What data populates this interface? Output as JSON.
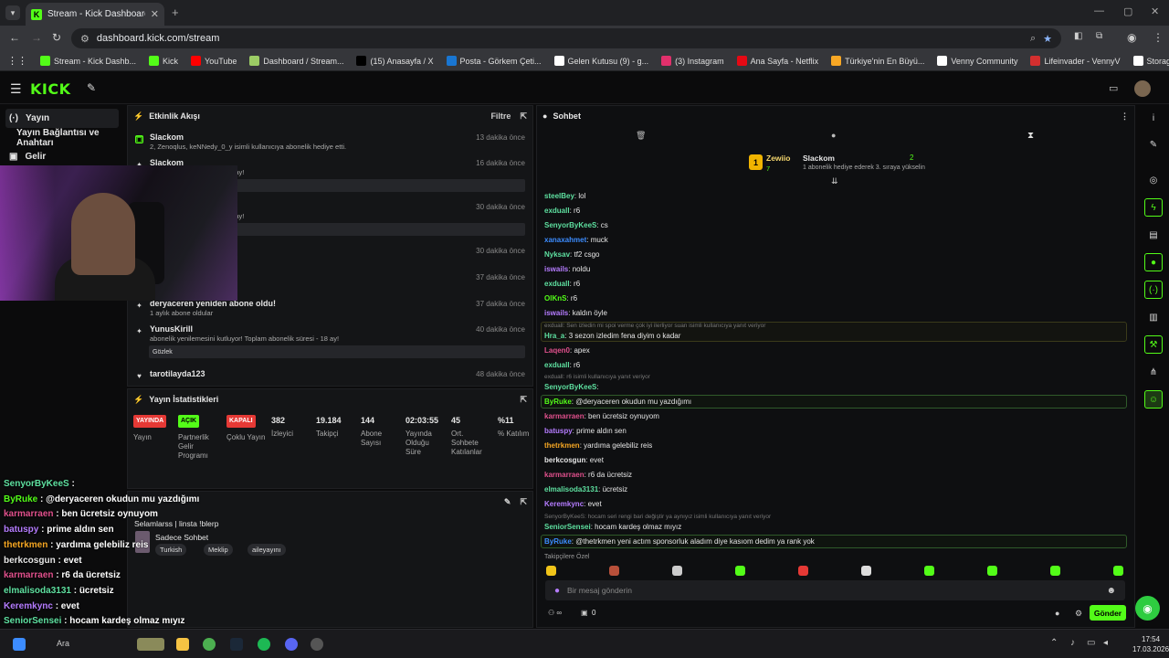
{
  "browser": {
    "tab_title": "Stream - Kick Dashboard",
    "url": "dashboard.kick.com/stream",
    "bookmarks": [
      {
        "label": "Stream - Kick Dashb...",
        "icon": "kick-icon",
        "color": "#53fc18"
      },
      {
        "label": "Kick",
        "icon": "kick-icon",
        "color": "#53fc18"
      },
      {
        "label": "YouTube",
        "icon": "youtube-icon",
        "color": "#ff0000"
      },
      {
        "label": "Dashboard / Stream...",
        "icon": "dashboard-icon",
        "color": "#9ccc65"
      },
      {
        "label": "(15) Anasayfa / X",
        "icon": "x-icon",
        "color": "#000000"
      },
      {
        "label": "Posta - Görkem Çeti...",
        "icon": "mail-icon",
        "color": "#1976d2"
      },
      {
        "label": "Gelen Kutusu (9) - g...",
        "icon": "google-icon",
        "color": "#ffffff"
      },
      {
        "label": "(3) Instagram",
        "icon": "instagram-icon",
        "color": "#e1306c"
      },
      {
        "label": "Ana Sayfa - Netflix",
        "icon": "netflix-icon",
        "color": "#e50914"
      },
      {
        "label": "Türkiye'nin En Büyü...",
        "icon": "site-icon",
        "color": "#f9a825"
      },
      {
        "label": "Venny Community",
        "icon": "venny-icon",
        "color": "#ffffff"
      },
      {
        "label": "Lifeinvader - VennyV",
        "icon": "lifeinvader-icon",
        "color": "#d32f2f"
      },
      {
        "label": "Storage | Fivemanage",
        "icon": "storage-icon",
        "color": "#ffffff"
      }
    ]
  },
  "header": {
    "logo": "KICK"
  },
  "sidebar": {
    "items": [
      {
        "label": "Yayın",
        "icon": "broadcast-icon"
      },
      {
        "label": "Yayın Bağlantısı ve Anahtarı",
        "icon": "key-icon"
      },
      {
        "label": "Gelir",
        "icon": "revenue-icon"
      }
    ]
  },
  "overlay_chat": [
    {
      "user": "SenyorByKeeS",
      "text": " : ",
      "color": "#5ee0a0"
    },
    {
      "user": "ByRuke",
      "text": " : @deryaceren okudun mu yazdığımı",
      "color": "#53fc18"
    },
    {
      "user": "karmarraen",
      "text": " : ben ücretsiz oynuyom",
      "color": "#e0508c"
    },
    {
      "user": "batuspy",
      "text": " : prime aldın sen",
      "color": "#b57cff"
    },
    {
      "user": "thetrkmen",
      "text": " : yardıma gelebiliz reis",
      "color": "#f5a623"
    },
    {
      "user": "berkcosgun",
      "text": " : evet",
      "color": "#e6e6e6"
    },
    {
      "user": "karmarraen",
      "text": " : r6 da ücretsiz",
      "color": "#e0508c"
    },
    {
      "user": "elmalisoda3131",
      "text": " : ücretsiz",
      "color": "#5ee0a0"
    },
    {
      "user": "Keremkync",
      "text": " : evet",
      "color": "#b57cff"
    },
    {
      "user": "SeniorSensei",
      "text": " : hocam kardeş olmaz mıyız",
      "color": "#5ee0a0"
    },
    {
      "user": "ByRuke",
      "text": " : @thetrkmen yeni actım sponsorluk aladım diye",
      "color": "#3c8cff"
    },
    {
      "user": "",
      "text": "m dedim ya rank yok",
      "color": "#e6e6e6"
    }
  ],
  "activity": {
    "title": "Etkinlik Akışı",
    "filter_label": "Filtre",
    "events": [
      {
        "name": "Slackom",
        "time": "13 dakika önce",
        "desc": "2, Zenoqlus, keNNedy_0_y isimli kullanıcıya abonelik hediye etti."
      },
      {
        "name": "Slackom",
        "time": "16 dakika önce",
        "desc": "Toplam abonelik süresi - 14 ay!",
        "box": "ice 14. aylara olur inşallah"
      },
      {
        "name": "",
        "time": "30 dakika önce",
        "desc": "Toplam abonelik süresi - 16 ay!",
        "box": ""
      },
      {
        "name": "",
        "time": "30 dakika önce",
        "desc": ""
      },
      {
        "name": "oldu!",
        "time": "37 dakika önce",
        "desc": ""
      },
      {
        "name": "deryaceren yeniden abone oldu!",
        "time": "37 dakika önce",
        "desc": "1 aylık abone oldular"
      },
      {
        "name": "YunusKirill",
        "time": "40 dakika önce",
        "desc": "abonelik yenilemesini kutluyor! Toplam abonelik süresi - 18 ay!",
        "box": "Gözlek"
      },
      {
        "name": "tarotilayda123",
        "time": "48 dakika önce",
        "desc": ""
      }
    ]
  },
  "stats": {
    "title": "Yayın İstatistikleri",
    "badges": [
      {
        "badge": "YAYINDA",
        "label": "Yayın",
        "color": "#e53935"
      },
      {
        "badge": "AÇIK",
        "label": "Partnerlik Gelir Programı",
        "color": "#53fc18"
      },
      {
        "badge": "KAPALI",
        "label": "Çoklu Yayın",
        "color": "#e53935"
      }
    ],
    "values": [
      {
        "value": "382",
        "label": "İzleyici"
      },
      {
        "value": "19.184",
        "label": "Takipçi"
      },
      {
        "value": "144",
        "label": "Abone Sayısı"
      },
      {
        "value": "02:03:55",
        "label": "Yayında Olduğu Süre"
      },
      {
        "value": "45",
        "label": "Ort. Sohbete Katılanlar"
      },
      {
        "value": "%11",
        "label": "% Katılım"
      }
    ]
  },
  "stream_info": {
    "title_text": "Selamlarss | linsta !blerp",
    "category": "Sadece Sohbet",
    "tags": [
      "Turkish",
      "Meklip",
      "aileyayını"
    ]
  },
  "chat": {
    "title": "Sohbet",
    "leaderboard": {
      "first": "Zewiio",
      "first_count": "7",
      "second": "Slackom",
      "second_count": "2",
      "info": "1 abonelik hediye ederek 3. sıraya yükselin"
    },
    "messages": [
      {
        "user": "steelBey",
        "text": ": lol",
        "color": "#5ee0a0"
      },
      {
        "user": "exduall",
        "text": ": r6",
        "color": "#5ee0a0"
      },
      {
        "user": "SenyorByKeeS",
        "text": ": cs",
        "color": "#5ee0a0"
      },
      {
        "user": "xanaxahmet",
        "text": ": muck",
        "color": "#3c8cff"
      },
      {
        "user": "Nyksav",
        "text": ": tf2 csgo",
        "color": "#5ee0a0"
      },
      {
        "user": "iswails",
        "text": ": noldu",
        "color": "#b57cff"
      },
      {
        "user": "exduall",
        "text": ": r6",
        "color": "#5ee0a0"
      },
      {
        "user": "OlKnS",
        "text": ": r6",
        "color": "#53fc18"
      },
      {
        "user": "iswails",
        "text": ": kaldın öyle",
        "color": "#b57cff"
      },
      {
        "reply": "exduall: Sen izledin mi spoi verme çok iyi ilerliyor suan isimli kullanıcıya yanıt veriyor"
      },
      {
        "user": "Hra_a",
        "text": ": 3 sezon izledim fena diyim o kadar",
        "color": "#5ee0a0"
      },
      {
        "user": "Laqen0",
        "text": ": apex",
        "color": "#e0508c"
      },
      {
        "user": "exduall",
        "text": ": r6",
        "color": "#5ee0a0"
      },
      {
        "reply": "exduall: r6 isimli kullanıcıya yanıt veriyor"
      },
      {
        "user": "SenyorByKeeS",
        "text": ":",
        "color": "#5ee0a0"
      },
      {
        "user": "ByRuke",
        "text": ": @deryaceren okudun mu yazdığımı",
        "color": "#53fc18"
      },
      {
        "user": "karmarraen",
        "text": ": ben ücretsiz oynuyom",
        "color": "#e0508c"
      },
      {
        "user": "batuspy",
        "text": ": prime aldın sen",
        "color": "#b57cff"
      },
      {
        "user": "thetrkmen",
        "text": ": yardıma gelebiliz reis",
        "color": "#f5a623"
      },
      {
        "user": "berkcosgun",
        "text": ": evet",
        "color": "#e6e6e6"
      },
      {
        "user": "karmarraen",
        "text": ": r6 da ücretsiz",
        "color": "#e0508c"
      },
      {
        "user": "elmalisoda3131",
        "text": ": ücretsiz",
        "color": "#5ee0a0"
      },
      {
        "user": "Keremkync",
        "text": ": evet",
        "color": "#b57cff"
      },
      {
        "reply": "SenyorByKeeS: hocam seri rengi bari değiştir ya aynıyız isimli kullanıcıya yanıt veriyor"
      },
      {
        "user": "SeniorSensei",
        "text": ": hocam kardeş olmaz mıyız",
        "color": "#5ee0a0"
      },
      {
        "user": "ByRuke",
        "text": ": @thetrkmen yeni actım sponsorluk aladım diye kasıom dedim ya rank yok",
        "color": "#3c8cff"
      }
    ],
    "emote_label": "Takipçilere Özel",
    "input_placeholder": "Bir mesaj gönderin",
    "send_label": "Gönder",
    "points": "0"
  },
  "taskbar": {
    "search": "Ara",
    "time": "17:54",
    "date": "17.03.2026"
  }
}
